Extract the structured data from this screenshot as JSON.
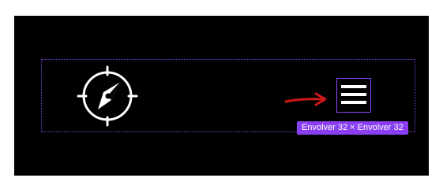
{
  "badge": {
    "label": "Envolver  32 × Envolver  32"
  },
  "icons": {
    "compass": "compass-icon",
    "menu": "menu-icon",
    "arrow": "arrow-right-icon"
  },
  "colors": {
    "canvas": "#000000",
    "selection": "#8a3ff3",
    "arrow": "#d01818",
    "icon": "#ffffff"
  }
}
